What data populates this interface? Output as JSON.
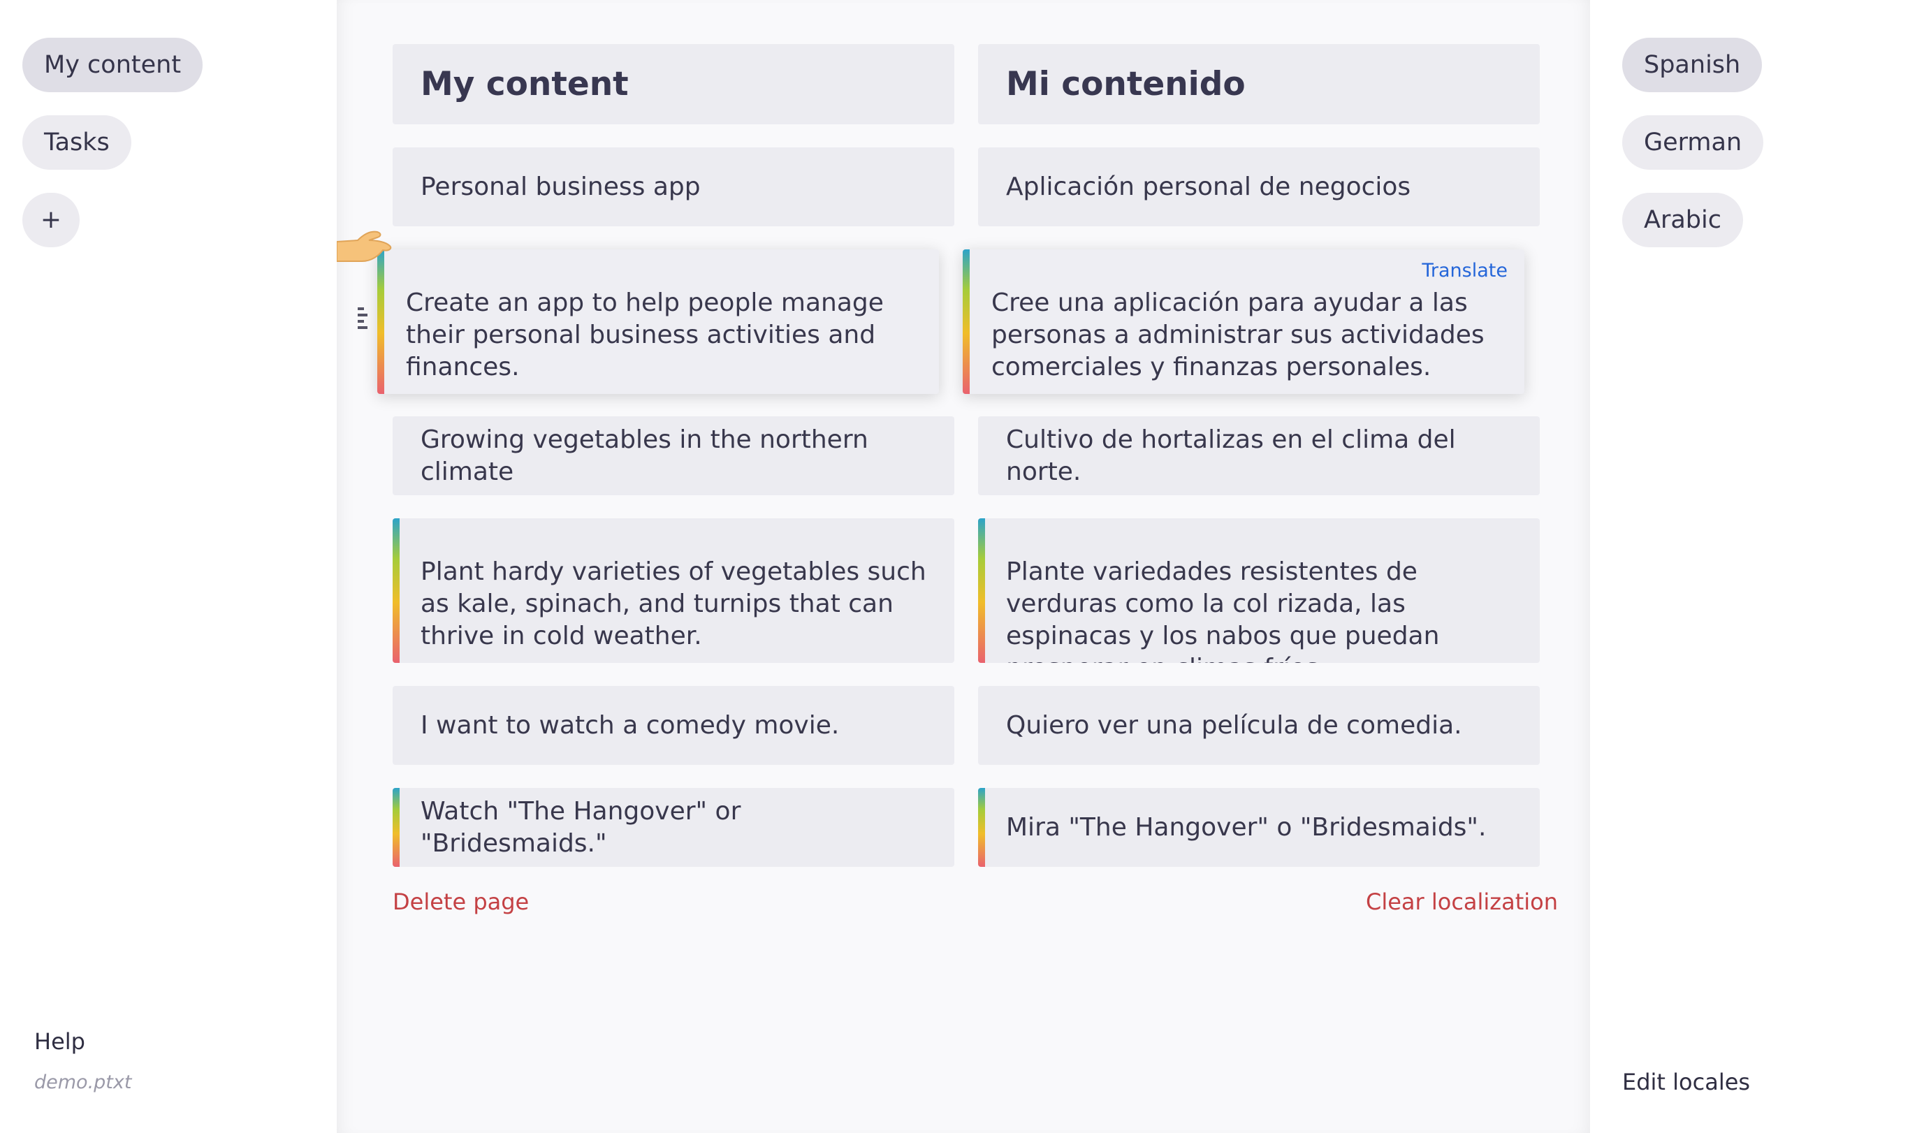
{
  "nav": {
    "items": [
      {
        "label": "My content",
        "active": true
      },
      {
        "label": "Tasks",
        "active": false
      }
    ],
    "add_label": "+",
    "help_label": "Help",
    "file_name": "demo.ptxt"
  },
  "locales": {
    "items": [
      {
        "label": "Spanish",
        "active": true
      },
      {
        "label": "German",
        "active": false
      },
      {
        "label": "Arabic",
        "active": false
      }
    ],
    "edit_label": "Edit locales"
  },
  "editor": {
    "rows": [
      {
        "source": "My content",
        "target": "Mi contenido"
      },
      {
        "source": "Personal business app",
        "target": "Aplicación personal de negocios"
      },
      {
        "source": "Create an app to help people manage their personal business activities and finances.",
        "target": "Cree una aplicación para ayudar a las personas a administrar sus actividades comerciales y finanzas personales."
      },
      {
        "source": "Growing vegetables in the northern climate",
        "target": "Cultivo de hortalizas en el clima del norte."
      },
      {
        "source": "Plant hardy varieties of vegetables such as kale, spinach, and turnips that can thrive in cold weather.",
        "target": "Plante variedades resistentes de verduras como la col rizada, las espinacas y los nabos que puedan prosperar en climas fríos."
      },
      {
        "source": "I want to watch a comedy movie.",
        "target": "Quiero ver una película de comedia."
      },
      {
        "source": "Watch \"The Hangover\" or \"Bridesmaids.\"",
        "target": "Mira \"The Hangover\" o \"Bridesmaids\"."
      }
    ],
    "translate_label": "Translate",
    "delete_page_label": "Delete page",
    "clear_localization_label": "Clear localization"
  },
  "colors": {
    "accent_link": "#2566d9",
    "danger": "#c44144",
    "card_bg": "#ececf1"
  },
  "icons": [
    "hand-pointer-icon",
    "drag-handle-icon",
    "plus-icon"
  ]
}
